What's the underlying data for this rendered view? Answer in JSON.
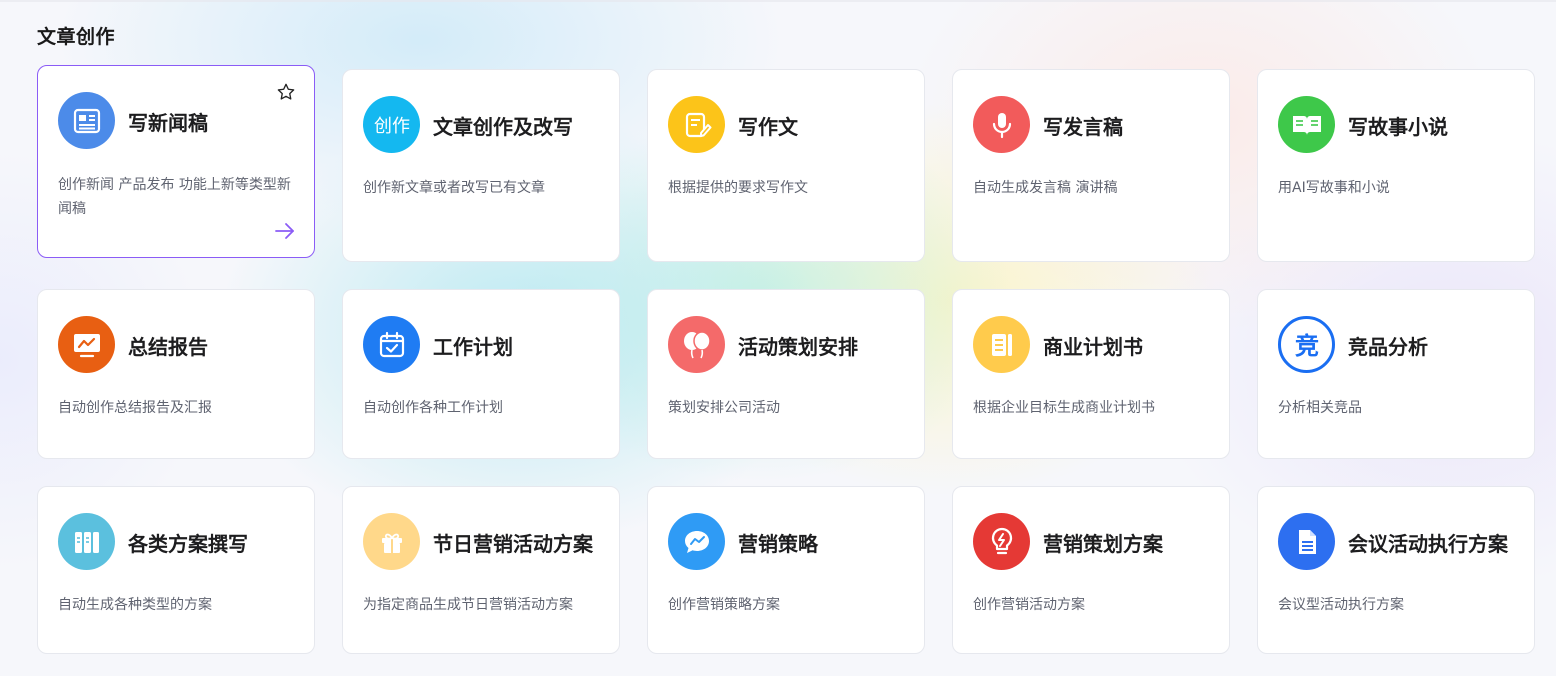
{
  "section": {
    "title": "文章创作"
  },
  "cards": [
    {
      "title": "写新闻稿",
      "desc": "创作新闻 产品发布 功能上新等类型新闻稿",
      "icon": "news-icon",
      "color": "#4c8be9"
    },
    {
      "title": "文章创作及改写",
      "desc": "创作新文章或者改写已有文章",
      "icon": "chuangzuo-text-icon",
      "color": "#14b8f0"
    },
    {
      "title": "写作文",
      "desc": "根据提供的要求写作文",
      "icon": "document-pen-icon",
      "color": "#fcc419"
    },
    {
      "title": "写发言稿",
      "desc": "自动生成发言稿 演讲稿",
      "icon": "microphone-icon",
      "color": "#f25b5b"
    },
    {
      "title": "写故事小说",
      "desc": "用AI写故事和小说",
      "icon": "open-book-icon",
      "color": "#3ec84a"
    },
    {
      "title": "总结报告",
      "desc": "自动创作总结报告及汇报",
      "icon": "presentation-chart-icon",
      "color": "#e85f12"
    },
    {
      "title": "工作计划",
      "desc": "自动创作各种工作计划",
      "icon": "calendar-check-icon",
      "color": "#1f7cf3"
    },
    {
      "title": "活动策划安排",
      "desc": "策划安排公司活动",
      "icon": "balloons-icon",
      "color": "#f46a6a"
    },
    {
      "title": "商业计划书",
      "desc": "根据企业目标生成商业计划书",
      "icon": "document-list-icon",
      "color": "#ffcb4c"
    },
    {
      "title": "竞品分析",
      "desc": "分析相关竞品",
      "icon": "jing-character-icon",
      "color": "#1a6ef2"
    },
    {
      "title": "各类方案撰写",
      "desc": "自动生成各种类型的方案",
      "icon": "binders-icon",
      "color": "#5bc0de"
    },
    {
      "title": "节日营销活动方案",
      "desc": "为指定商品生成节日营销活动方案",
      "icon": "gift-icon",
      "color": "#ffd88a"
    },
    {
      "title": "营销策略",
      "desc": "创作营销策略方案",
      "icon": "chat-trend-icon",
      "color": "#2f9bf5"
    },
    {
      "title": "营销策划方案",
      "desc": "创作营销活动方案",
      "icon": "lightbulb-icon",
      "color": "#e53935"
    },
    {
      "title": "会议活动执行方案",
      "desc": "会议型活动执行方案",
      "icon": "file-text-icon",
      "color": "#2d6ff0"
    }
  ]
}
